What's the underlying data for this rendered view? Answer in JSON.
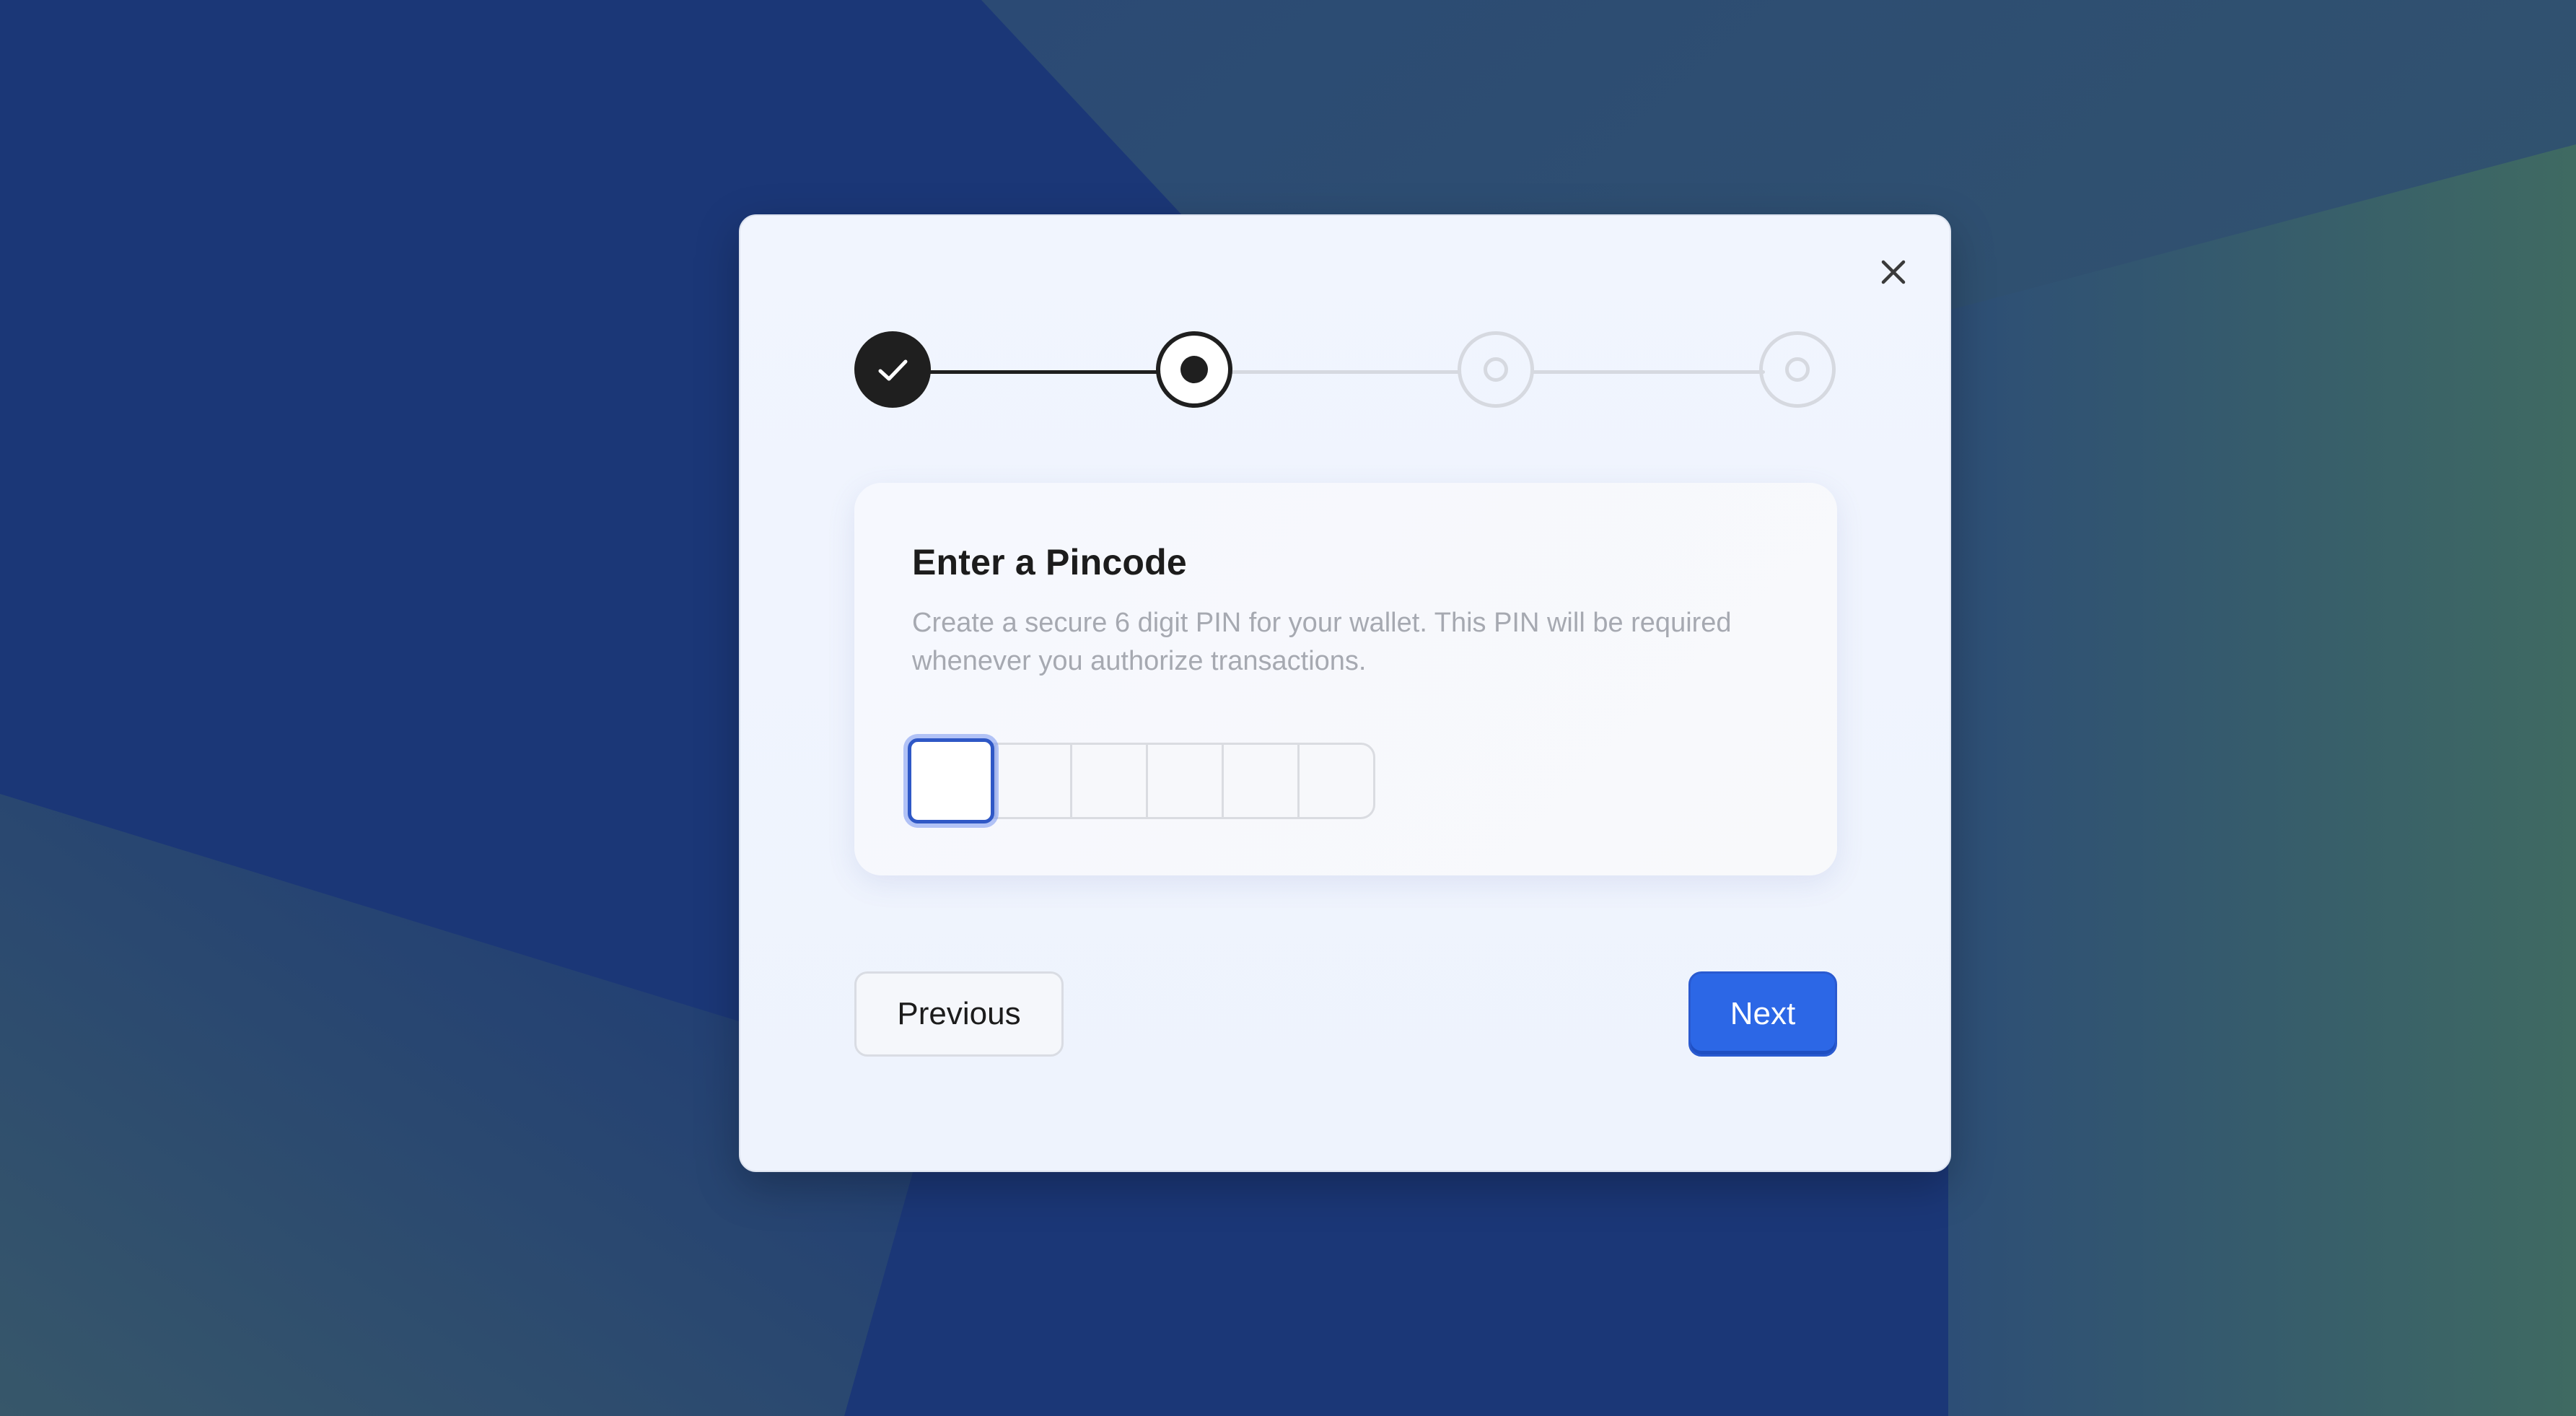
{
  "dialog": {
    "close_icon": "close-icon",
    "stepper": {
      "steps": [
        {
          "state": "completed",
          "icon": "check-icon"
        },
        {
          "state": "active",
          "icon": "dot-icon"
        },
        {
          "state": "pending",
          "icon": "ring-icon"
        },
        {
          "state": "pending",
          "icon": "ring-icon"
        }
      ]
    },
    "card": {
      "title": "Enter a Pincode",
      "description": "Create a secure 6 digit PIN for your wallet. This PIN will be required whenever you authorize transactions.",
      "pin_digits": [
        "",
        "",
        "",
        "",
        "",
        ""
      ],
      "focused_index": 0
    },
    "buttons": {
      "previous_label": "Previous",
      "next_label": "Next"
    }
  },
  "colors": {
    "background": "#1b3777",
    "accent": "#2c67e6",
    "step_done": "#1f1f1f",
    "step_pending": "#d6d9e0",
    "focus_ring": "#2f58c6"
  }
}
